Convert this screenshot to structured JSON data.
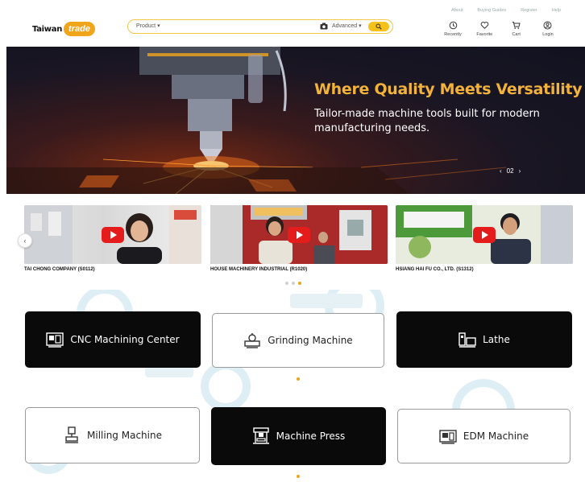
{
  "header": {
    "logo_text": "Taiwan",
    "logo_badge": "trade",
    "search": {
      "category": "Product ▾",
      "placeholder": "",
      "advanced": "Advanced ▾"
    },
    "top_links": [
      "About",
      "Buying Guides",
      "Register",
      "Help"
    ],
    "nav": [
      {
        "label": "Recently",
        "icon": "clock-icon"
      },
      {
        "label": "Favorite",
        "icon": "heart-icon"
      },
      {
        "label": "Cart",
        "icon": "cart-icon"
      },
      {
        "label": "Login",
        "icon": "user-icon"
      }
    ]
  },
  "hero": {
    "title": "Where Quality Meets Versatility",
    "subtitle": "Tailor-made machine tools built for modern manufacturing needs.",
    "pager": "02",
    "prev": "‹",
    "next": "›"
  },
  "videos": {
    "items": [
      {
        "caption": "TAI CHONG COMPANY (S0112)"
      },
      {
        "caption": "HOUSE MACHINERY INDUSTRIAL (R1020)"
      },
      {
        "caption": "HSIANG HAI FU CO., LTD. (S1312)"
      }
    ],
    "prev_arrow": "‹"
  },
  "categories": [
    {
      "label": "CNC Machining Center",
      "icon": "cnc-machine-icon",
      "style": "dark"
    },
    {
      "label": "Grinding Machine",
      "icon": "grinder-icon",
      "style": "light"
    },
    {
      "label": "Lathe",
      "icon": "lathe-icon",
      "style": "dark"
    },
    {
      "label": "Milling Machine",
      "icon": "milling-icon",
      "style": "light"
    },
    {
      "label": "Machine Press",
      "icon": "press-icon",
      "style": "dark"
    },
    {
      "label": "EDM Machine",
      "icon": "edm-icon",
      "style": "light"
    }
  ],
  "colors": {
    "accent": "#f0a51a",
    "search_button": "#f5c21b",
    "hero_title": "#f3b23a",
    "dark_tile": "#0a0a0a"
  }
}
